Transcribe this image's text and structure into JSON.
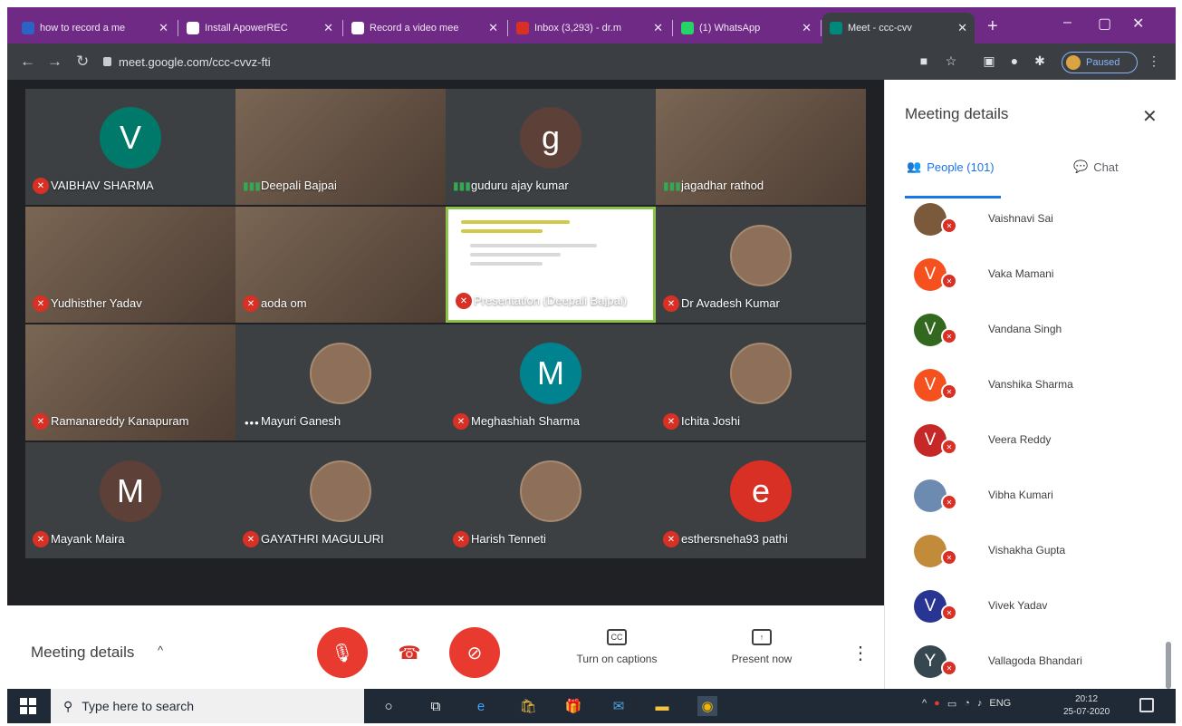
{
  "browser": {
    "tabs": [
      {
        "label": "how to record a me",
        "color": "#2b64c4",
        "active": false
      },
      {
        "label": "Install ApowerREC",
        "color": "#ffffff",
        "active": false
      },
      {
        "label": "Record a video mee",
        "color": "#ffffff",
        "active": false
      },
      {
        "label": "Inbox (3,293) - dr.m",
        "color": "#d93025",
        "active": false
      },
      {
        "label": "(1) WhatsApp",
        "color": "#25d366",
        "active": false
      },
      {
        "label": "Meet - ccc-cvv",
        "color": "#00897b",
        "active": true
      }
    ],
    "new_tab": "+",
    "window_controls": [
      "–",
      "▢",
      "✕"
    ],
    "address": "meet.google.com/ccc-cvvz-fti",
    "profile_status": "Paused"
  },
  "grid": {
    "tiles": [
      {
        "name": "VAIBHAV SHARMA",
        "kind": "letter",
        "letter": "V",
        "avatar_color": "#00796b",
        "status": "muted"
      },
      {
        "name": "Deepali Bajpai",
        "kind": "video",
        "status": "speaking"
      },
      {
        "name": "guduru ajay kumar",
        "kind": "letter",
        "letter": "g",
        "avatar_color": "#5d4037",
        "status": "speaking"
      },
      {
        "name": "jagadhar rathod",
        "kind": "video",
        "status": "speaking"
      },
      {
        "name": "Yudhisther Yadav",
        "kind": "video",
        "status": "muted"
      },
      {
        "name": "aoda om",
        "kind": "video",
        "status": "muted"
      },
      {
        "name": "Presentation (Deepali Bajpai)",
        "kind": "presentation",
        "status": "muted"
      },
      {
        "name": "Dr Avadesh Kumar",
        "kind": "photo",
        "status": "muted"
      },
      {
        "name": "Ramanareddy Kanapuram",
        "kind": "video",
        "status": "muted"
      },
      {
        "name": "Mayuri Ganesh",
        "kind": "photo",
        "status": "more"
      },
      {
        "name": "Meghashiah Sharma",
        "kind": "letter",
        "letter": "M",
        "avatar_color": "#00838f",
        "status": "muted"
      },
      {
        "name": "Ichita Joshi",
        "kind": "photo",
        "status": "muted"
      },
      {
        "name": "Mayank Maira",
        "kind": "letter",
        "letter": "M",
        "avatar_color": "#5d4037",
        "status": "muted"
      },
      {
        "name": "GAYATHRI MAGULURI",
        "kind": "photo",
        "status": "muted"
      },
      {
        "name": "Harish Tenneti",
        "kind": "photo",
        "status": "muted"
      },
      {
        "name": "esthersneha93 pathi",
        "kind": "letter",
        "letter": "e",
        "avatar_color": "#d93025",
        "status": "muted"
      }
    ]
  },
  "bottom_bar": {
    "meeting_details": "Meeting details",
    "captions_label": "Turn on captions",
    "captions_icon": "CC",
    "present_label": "Present now"
  },
  "panel": {
    "title": "Meeting details",
    "people_tab": "People (101)",
    "chat_tab": "Chat",
    "people": [
      {
        "name": "Vaishnavi Sai",
        "letter": "",
        "color": "#7a5a3a"
      },
      {
        "name": "Vaka Mamani",
        "letter": "V",
        "color": "#f4511e"
      },
      {
        "name": "Vandana Singh",
        "letter": "V",
        "color": "#33691e"
      },
      {
        "name": "Vanshika Sharma",
        "letter": "V",
        "color": "#f4511e"
      },
      {
        "name": "Veera Reddy",
        "letter": "V",
        "color": "#c62828"
      },
      {
        "name": "Vibha Kumari",
        "letter": "",
        "color": "#6d8bb0"
      },
      {
        "name": "Vishakha Gupta",
        "letter": "",
        "color": "#c28b3a"
      },
      {
        "name": "Vivek Yadav",
        "letter": "V",
        "color": "#283593"
      },
      {
        "name": "Vallagoda Bhandari",
        "letter": "Y",
        "color": "#37474f"
      }
    ]
  },
  "taskbar": {
    "search_placeholder": "Type here to search",
    "lang": "ENG",
    "time": "20:12",
    "date": "25-07-2020"
  }
}
